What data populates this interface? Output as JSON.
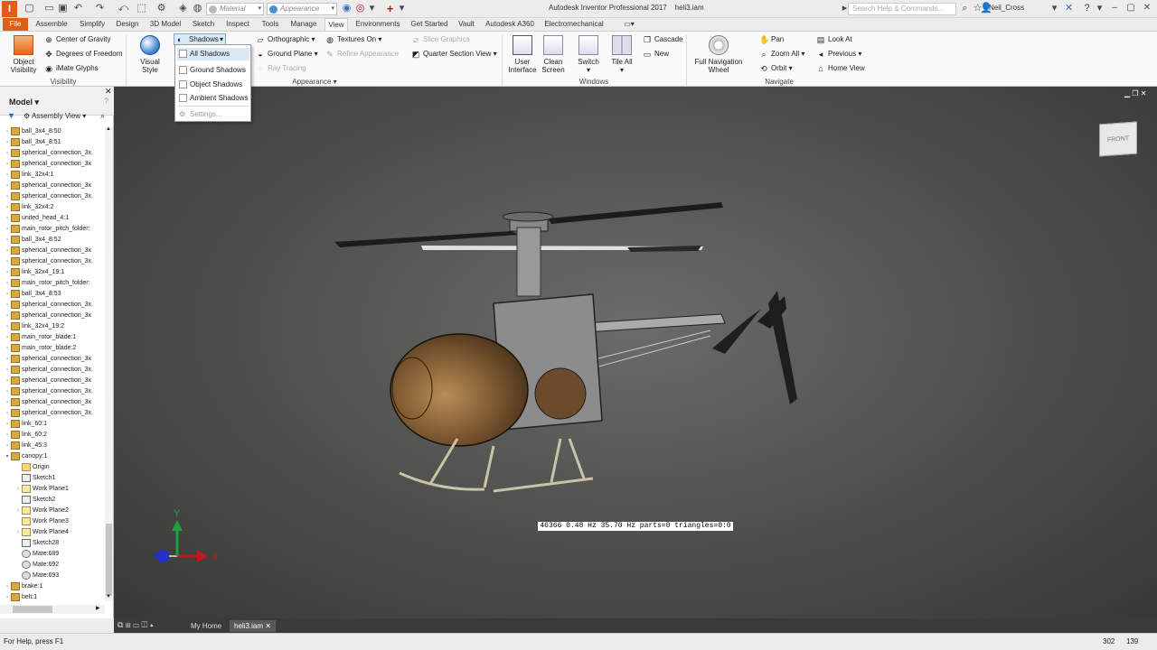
{
  "app": {
    "logo_letter": "I",
    "title": "Autodesk Inventor Professional 2017",
    "document": "heli3.iam",
    "search_placeholder": "Search Help & Commands...",
    "user": "Neil_Cross"
  },
  "quick_access": {
    "material": "Material",
    "appearance": "Appearance"
  },
  "tabs": [
    "File",
    "Assemble",
    "Simplify",
    "Design",
    "3D Model",
    "Sketch",
    "Inspect",
    "Tools",
    "Manage",
    "View",
    "Environments",
    "Get Started",
    "Vault",
    "Autodesk A360",
    "Electromechanical"
  ],
  "active_tab": "View",
  "ribbon": {
    "visibility": {
      "label": "Visibility",
      "object_visibility": "Object Visibility",
      "center_of_gravity": "Center of Gravity",
      "degrees_of_freedom": "Degrees of Freedom",
      "imate_glyphs": "iMate Glyphs"
    },
    "appearance": {
      "label": "Appearance",
      "visual_style": "Visual Style",
      "shadows": "Shadows",
      "orthographic": "Orthographic",
      "ground_plane": "Ground Plane",
      "ray_tracing": "Ray Tracing",
      "textures_on": "Textures On",
      "refine_appearance": "Refine Appearance",
      "slice_graphics": "Slice Graphics",
      "quarter_section_view": "Quarter Section View"
    },
    "windows": {
      "label": "Windows",
      "user_interface": "User Interface",
      "clean_screen": "Clean Screen",
      "switch": "Switch",
      "tile_all": "Tile All",
      "cascade": "Cascade",
      "new": "New"
    },
    "navigate": {
      "label": "Navigate",
      "full_navigation_wheel": "Full Navigation Wheel",
      "pan": "Pan",
      "zoom_all": "Zoom All",
      "orbit": "Orbit",
      "look_at": "Look At",
      "previous": "Previous",
      "home_view": "Home View"
    }
  },
  "shadows_menu": {
    "all_shadows": "All Shadows",
    "ground_shadows": "Ground Shadows",
    "object_shadows": "Object Shadows",
    "ambient_shadows": "Ambient Shadows",
    "settings": "Settings..."
  },
  "browser": {
    "title": "Model",
    "view": "Assembly View",
    "items": [
      {
        "label": "ball_3x4_8:50",
        "type": "part",
        "expand": true
      },
      {
        "label": "ball_3x4_8:51",
        "type": "part",
        "expand": true
      },
      {
        "label": "spherical_connection_3x",
        "type": "part",
        "expand": true
      },
      {
        "label": "spherical_connection_3x",
        "type": "part",
        "expand": true
      },
      {
        "label": "link_32x4:1",
        "type": "part",
        "expand": true
      },
      {
        "label": "spherical_connection_3x",
        "type": "part",
        "expand": true
      },
      {
        "label": "spherical_connection_3x",
        "type": "part",
        "expand": true
      },
      {
        "label": "link_32x4:2",
        "type": "part",
        "expand": true
      },
      {
        "label": "united_head_4:1",
        "type": "part",
        "expand": true
      },
      {
        "label": "main_rotor_pitch_folder:",
        "type": "part",
        "expand": true
      },
      {
        "label": "ball_3x4_8:52",
        "type": "part",
        "expand": true
      },
      {
        "label": "spherical_connection_3x",
        "type": "part",
        "expand": true
      },
      {
        "label": "spherical_connection_3x",
        "type": "part",
        "expand": true
      },
      {
        "label": "link_32x4_19:1",
        "type": "part",
        "expand": true
      },
      {
        "label": "main_rotor_pitch_folder:",
        "type": "part",
        "expand": true
      },
      {
        "label": "ball_3x4_8:53",
        "type": "part",
        "expand": true
      },
      {
        "label": "spherical_connection_3x",
        "type": "part",
        "expand": true
      },
      {
        "label": "spherical_connection_3x",
        "type": "part",
        "expand": true
      },
      {
        "label": "link_32x4_19:2",
        "type": "part",
        "expand": true
      },
      {
        "label": "main_rotor_blade:1",
        "type": "part",
        "expand": true
      },
      {
        "label": "main_rotor_blade:2",
        "type": "part",
        "expand": true
      },
      {
        "label": "spherical_connection_3x",
        "type": "part",
        "expand": true
      },
      {
        "label": "spherical_connection_3x",
        "type": "part",
        "expand": true
      },
      {
        "label": "spherical_connection_3x",
        "type": "part",
        "expand": true
      },
      {
        "label": "spherical_connection_3x",
        "type": "part",
        "expand": true
      },
      {
        "label": "spherical_connection_3x",
        "type": "part",
        "expand": true
      },
      {
        "label": "spherical_connection_3x",
        "type": "part",
        "expand": true
      },
      {
        "label": "link_60:1",
        "type": "part",
        "expand": true
      },
      {
        "label": "link_60:2",
        "type": "part",
        "expand": true
      },
      {
        "label": "link_45:3",
        "type": "part",
        "expand": true
      },
      {
        "label": "canopy:1",
        "type": "part",
        "expand": true,
        "open": true
      },
      {
        "label": "Origin",
        "type": "folder",
        "indent": 1
      },
      {
        "label": "Sketch1",
        "type": "sketch",
        "indent": 1
      },
      {
        "label": "Work Plane1",
        "type": "plane",
        "indent": 1,
        "expand": true
      },
      {
        "label": "Sketch2",
        "type": "sketch",
        "indent": 1
      },
      {
        "label": "Work Plane2",
        "type": "plane",
        "indent": 1,
        "expand": true
      },
      {
        "label": "Work Plane3",
        "type": "plane",
        "indent": 1
      },
      {
        "label": "Work Plane4",
        "type": "plane",
        "indent": 1,
        "expand": true
      },
      {
        "label": "Sketch28",
        "type": "sketch",
        "indent": 1
      },
      {
        "label": "Mate:689",
        "type": "mate",
        "indent": 1
      },
      {
        "label": "Mate:692",
        "type": "mate",
        "indent": 1
      },
      {
        "label": "Mate:693",
        "type": "mate",
        "indent": 1
      },
      {
        "label": "brake:1",
        "type": "part",
        "expand": true
      },
      {
        "label": "belt:1",
        "type": "part",
        "expand": true
      }
    ]
  },
  "viewport": {
    "viewcube_label": "FRONT",
    "stats": "46366  0.48 Hz  35.70 Hz  parts=0 triangles=0:0",
    "axes": {
      "x": "X",
      "y": "Y",
      "z": "Z"
    }
  },
  "doc_tabs": {
    "home": "My Home",
    "active": "heli3.iam"
  },
  "status": {
    "help": "For Help, press F1",
    "count1": "302",
    "count2": "139"
  },
  "colors": {
    "accent": "#e05f16",
    "viewport_bg": "#555553",
    "x_axis": "#c0181e",
    "y_axis": "#1ea040",
    "z_axis": "#2030c8"
  }
}
